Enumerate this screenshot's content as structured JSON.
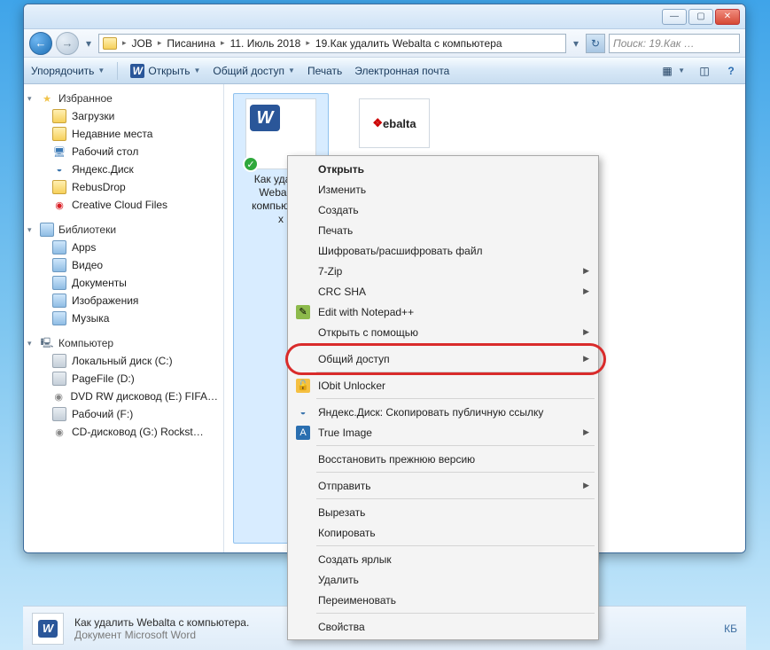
{
  "breadcrumb": {
    "root_icon": "folder",
    "parts": [
      "JOB",
      "Писанина",
      "11. Июль 2018",
      "19.Как удалить Webalta с компьютера"
    ]
  },
  "search": {
    "placeholder": "Поиск: 19.Как …"
  },
  "toolbar": {
    "organize": "Упорядочить",
    "open": "Открыть",
    "share": "Общий доступ",
    "print": "Печать",
    "email": "Электронная почта"
  },
  "nav": {
    "favorites": {
      "label": "Избранное",
      "items": [
        "Загрузки",
        "Недавние места",
        "Рабочий стол",
        "Яндекс.Диск",
        "RebusDrop",
        "Creative Cloud Files"
      ]
    },
    "libraries": {
      "label": "Библиотеки",
      "items": [
        "Apps",
        "Видео",
        "Документы",
        "Изображения",
        "Музыка"
      ]
    },
    "computer": {
      "label": "Компьютер",
      "items": [
        "Локальный диск (C:)",
        "PageFile (D:)",
        "DVD RW дисковод (E:) FIFA…",
        "Рабочий (F:)",
        "CD-дисковод (G:) Rockst…"
      ]
    }
  },
  "files": {
    "selected": {
      "name": "Как удалить Webalta с компьютера.docx",
      "caption": "Как удал…\nWebalt…\nкомпьюте…\nx"
    },
    "other": {
      "name": "webalta"
    }
  },
  "details": {
    "title": "Как удалить Webalta с компьютера.",
    "subtitle": "Документ Microsoft Word",
    "size_hint": "КБ"
  },
  "context_menu": {
    "open": "Открыть",
    "edit": "Изменить",
    "create": "Создать",
    "print": "Печать",
    "encrypt": "Шифровать/расшифровать файл",
    "sevenzip": "7-Zip",
    "crc": "CRC SHA",
    "notepad": "Edit with Notepad++",
    "openwith": "Открыть с помощью",
    "share": "Общий доступ",
    "iobit": "IObit Unlocker",
    "yandex": "Яндекс.Диск: Скопировать публичную ссылку",
    "trueimage": "True Image",
    "restore": "Восстановить прежнюю версию",
    "sendto": "Отправить",
    "cut": "Вырезать",
    "copy": "Копировать",
    "shortcut": "Создать ярлык",
    "delete": "Удалить",
    "rename": "Переименовать",
    "properties": "Свойства"
  }
}
